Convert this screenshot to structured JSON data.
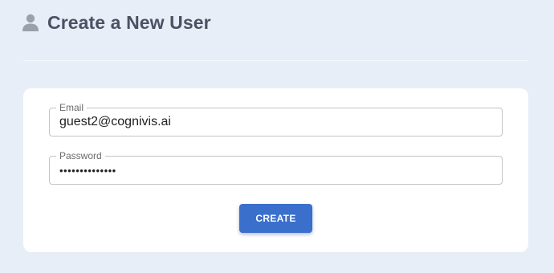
{
  "header": {
    "icon": "user-icon",
    "title": "Create a New User"
  },
  "form": {
    "email": {
      "label": "Email",
      "value": "guest2@cognivis.ai"
    },
    "password": {
      "label": "Password",
      "value": "••••••••••••••"
    },
    "submit_label": "CREATE"
  },
  "colors": {
    "page_background": "#e8eef7",
    "title_text": "#4a5263",
    "button": "#3a6fcc"
  }
}
